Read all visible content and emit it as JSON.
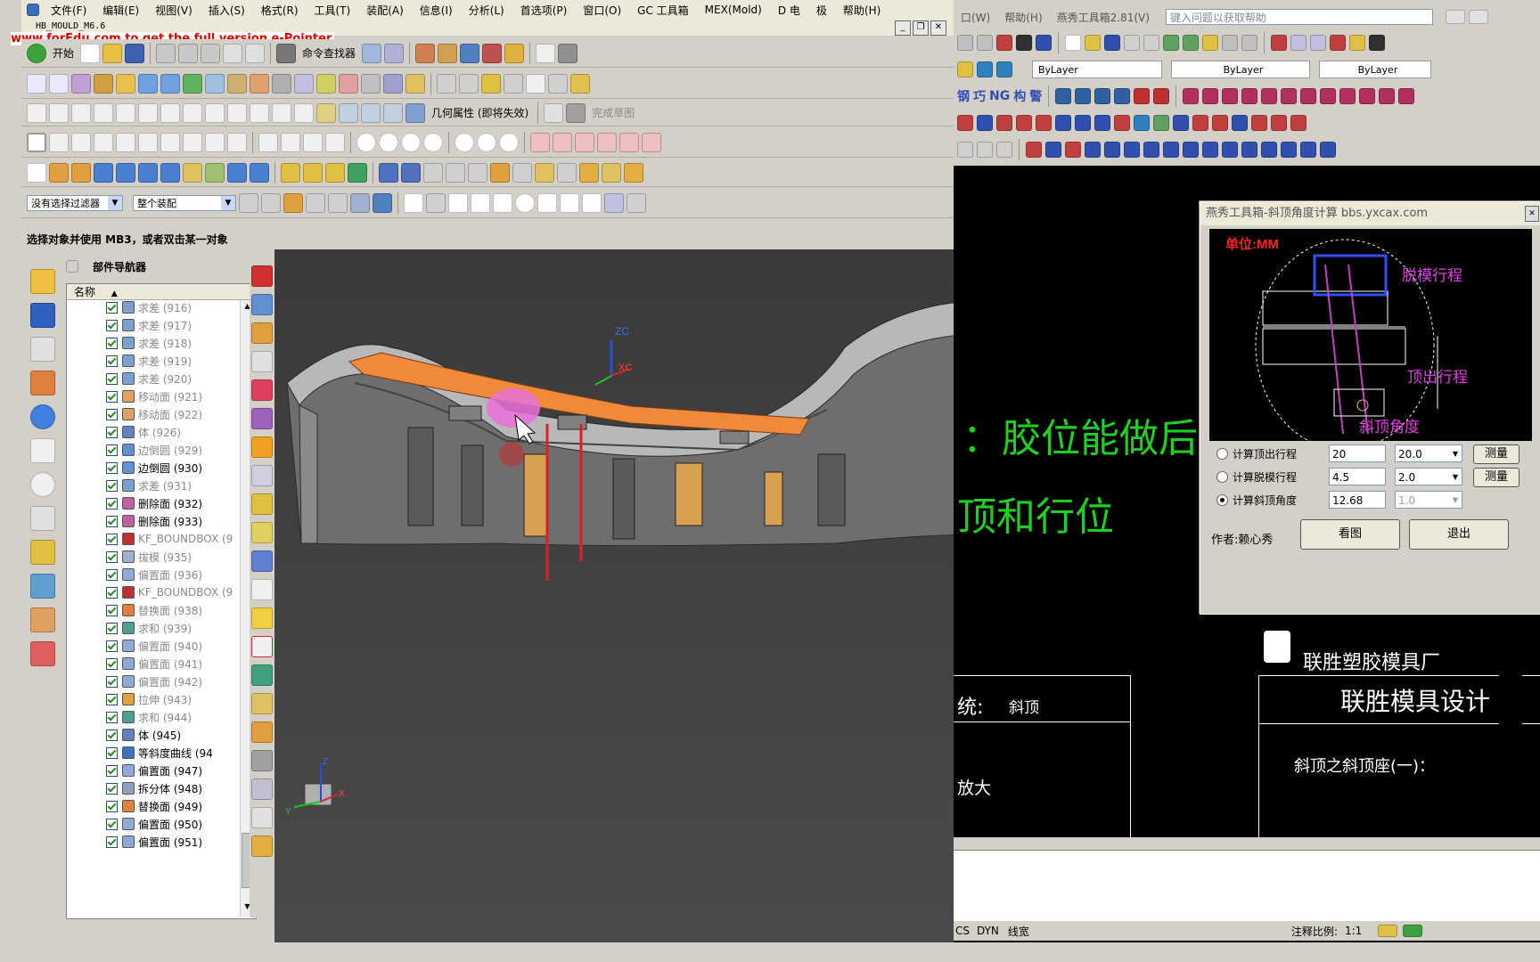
{
  "nx": {
    "menu": [
      "文件(F)",
      "编辑(E)",
      "视图(V)",
      "插入(S)",
      "格式(R)",
      "工具(T)",
      "装配(A)",
      "信息(I)",
      "分析(L)",
      "首选项(P)",
      "窗口(O)",
      "GC 工具箱",
      "MEX(Mold)",
      "D 电",
      "极",
      "帮助(H)"
    ],
    "subtitle": "HB_MOULD_M6.6",
    "watermark": "www.forEdu.com to get the full version e-Pointer.",
    "toolbar": {
      "start_label": "开始",
      "command_finder": "命令查找器",
      "geometry_property": "几何属性 (即将失效)",
      "finish_sketch": "完成草图"
    },
    "filters": {
      "selection_filter": "没有选择过滤器",
      "assembly_scope": "整个装配"
    },
    "status_prompt": "选择对象并使用 MB3，或者双击某一对象",
    "navigator": {
      "title": "部件导航器",
      "column_name": "名称",
      "rows": [
        {
          "label": "求差 (916)",
          "dim": true,
          "icon": "subtract-icon"
        },
        {
          "label": "求差 (917)",
          "dim": true,
          "icon": "subtract-icon"
        },
        {
          "label": "求差 (918)",
          "dim": true,
          "icon": "subtract-icon"
        },
        {
          "label": "求差 (919)",
          "dim": true,
          "icon": "subtract-icon"
        },
        {
          "label": "求差 (920)",
          "dim": true,
          "icon": "subtract-icon"
        },
        {
          "label": "移动面 (921)",
          "dim": true,
          "icon": "move-face-icon"
        },
        {
          "label": "移动面 (922)",
          "dim": true,
          "icon": "move-face-icon"
        },
        {
          "label": "体 (926)",
          "dim": true,
          "icon": "body-icon"
        },
        {
          "label": "边倒圆 (929)",
          "dim": true,
          "icon": "edge-blend-icon"
        },
        {
          "label": "边倒圆 (930)",
          "dim": false,
          "icon": "edge-blend-icon"
        },
        {
          "label": "求差 (931)",
          "dim": true,
          "icon": "subtract-icon"
        },
        {
          "label": "删除面 (932)",
          "dim": false,
          "icon": "delete-face-icon"
        },
        {
          "label": "删除面 (933)",
          "dim": false,
          "icon": "delete-face-icon"
        },
        {
          "label": "KF_BOUNDBOX (9",
          "dim": true,
          "icon": "boundbox-icon"
        },
        {
          "label": "拔模 (935)",
          "dim": true,
          "icon": "draft-icon"
        },
        {
          "label": "偏置面 (936)",
          "dim": true,
          "icon": "offset-face-icon"
        },
        {
          "label": "KF_BOUNDBOX (9",
          "dim": true,
          "icon": "boundbox-icon"
        },
        {
          "label": "替换面 (938)",
          "dim": true,
          "icon": "replace-face-icon"
        },
        {
          "label": "求和 (939)",
          "dim": true,
          "icon": "unite-icon"
        },
        {
          "label": "偏置面 (940)",
          "dim": true,
          "icon": "offset-face-icon"
        },
        {
          "label": "偏置面 (941)",
          "dim": true,
          "icon": "offset-face-icon"
        },
        {
          "label": "偏置面 (942)",
          "dim": true,
          "icon": "offset-face-icon"
        },
        {
          "label": "拉伸 (943)",
          "dim": true,
          "icon": "extrude-icon"
        },
        {
          "label": "求和 (944)",
          "dim": true,
          "icon": "unite-icon"
        },
        {
          "label": "体 (945)",
          "dim": false,
          "icon": "body-icon"
        },
        {
          "label": "等斜度曲线 (94",
          "dim": false,
          "icon": "isocline-icon"
        },
        {
          "label": "偏置面 (947)",
          "dim": false,
          "icon": "offset-face-icon"
        },
        {
          "label": "拆分体 (948)",
          "dim": false,
          "icon": "split-body-icon"
        },
        {
          "label": "替换面 (949)",
          "dim": false,
          "icon": "replace-face-icon"
        },
        {
          "label": "偏置面 (950)",
          "dim": false,
          "icon": "offset-face-icon"
        },
        {
          "label": "偏置面 (951)",
          "dim": false,
          "icon": "offset-face-icon"
        }
      ]
    },
    "axes": {
      "zc": "ZC",
      "xc": "XC",
      "z": "Z",
      "x": "X",
      "y": "Y"
    }
  },
  "cad": {
    "menu": [
      "口(W)",
      "帮助(H)",
      "燕秀工具箱2.81(V)"
    ],
    "help_placeholder": "键入问题以获取帮助",
    "bylayer": [
      "ByLayer",
      "ByLayer",
      "ByLayer"
    ],
    "tools_text": [
      "钢",
      "巧",
      "NG",
      "构",
      "警"
    ],
    "drawing": {
      "big_text_1": "：胶位能做后模",
      "big_text_2": "顶和行位",
      "company": "联胜塑胶模具厂",
      "design_title": "联胜模具设计",
      "system_label": "统:",
      "system_value": "斜顶",
      "enlarge": "放大",
      "subtitle": "斜顶之斜顶座(一)："
    },
    "status": {
      "left_items": [
        "CS",
        "DYN",
        "线宽"
      ],
      "annotation_scale_label": "注释比例:",
      "annotation_scale_value": "1:1"
    }
  },
  "dialog": {
    "title": "燕秀工具箱-斜顶角度计算  bbs.yxcax.com",
    "unit": "单位:MM",
    "labels": {
      "demold": "脱模行程",
      "eject": "顶出行程",
      "angle": "斜顶角度"
    },
    "options": [
      {
        "label": "计算顶出行程",
        "value": "20",
        "combo": "20.0",
        "button": "测量",
        "selected": false
      },
      {
        "label": "计算脱模行程",
        "value": "4.5",
        "combo": "2.0",
        "button": "测量",
        "selected": false
      },
      {
        "label": "计算斜顶角度",
        "value": "12.68",
        "combo": "1.0",
        "button": "",
        "selected": true
      }
    ],
    "author": "作者:赖心秀",
    "view_button": "看图",
    "exit_button": "退出"
  }
}
